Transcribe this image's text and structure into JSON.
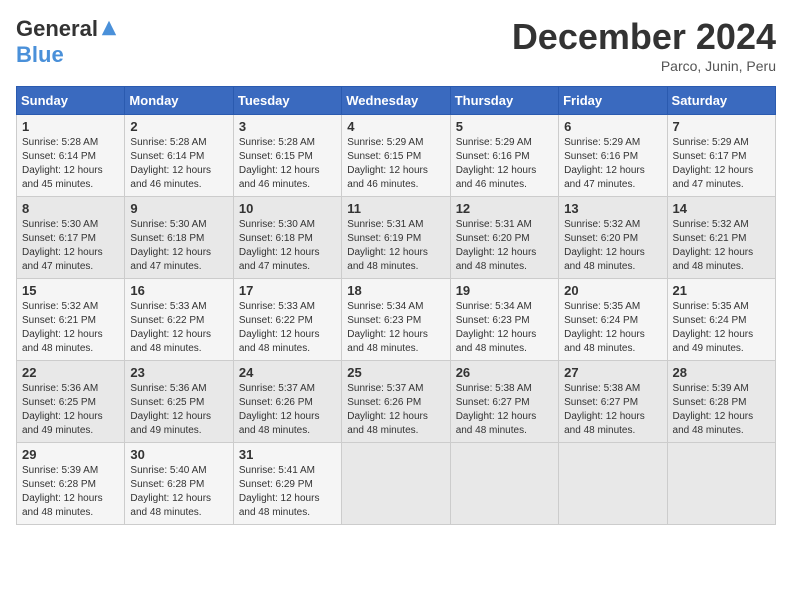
{
  "header": {
    "logo_general": "General",
    "logo_blue": "Blue",
    "title": "December 2024",
    "location": "Parco, Junin, Peru"
  },
  "weekdays": [
    "Sunday",
    "Monday",
    "Tuesday",
    "Wednesday",
    "Thursday",
    "Friday",
    "Saturday"
  ],
  "weeks": [
    [
      {
        "day": "1",
        "sunrise": "5:28 AM",
        "sunset": "6:14 PM",
        "daylight": "12 hours and 45 minutes."
      },
      {
        "day": "2",
        "sunrise": "5:28 AM",
        "sunset": "6:14 PM",
        "daylight": "12 hours and 46 minutes."
      },
      {
        "day": "3",
        "sunrise": "5:28 AM",
        "sunset": "6:15 PM",
        "daylight": "12 hours and 46 minutes."
      },
      {
        "day": "4",
        "sunrise": "5:29 AM",
        "sunset": "6:15 PM",
        "daylight": "12 hours and 46 minutes."
      },
      {
        "day": "5",
        "sunrise": "5:29 AM",
        "sunset": "6:16 PM",
        "daylight": "12 hours and 46 minutes."
      },
      {
        "day": "6",
        "sunrise": "5:29 AM",
        "sunset": "6:16 PM",
        "daylight": "12 hours and 47 minutes."
      },
      {
        "day": "7",
        "sunrise": "5:29 AM",
        "sunset": "6:17 PM",
        "daylight": "12 hours and 47 minutes."
      }
    ],
    [
      {
        "day": "8",
        "sunrise": "5:30 AM",
        "sunset": "6:17 PM",
        "daylight": "12 hours and 47 minutes."
      },
      {
        "day": "9",
        "sunrise": "5:30 AM",
        "sunset": "6:18 PM",
        "daylight": "12 hours and 47 minutes."
      },
      {
        "day": "10",
        "sunrise": "5:30 AM",
        "sunset": "6:18 PM",
        "daylight": "12 hours and 47 minutes."
      },
      {
        "day": "11",
        "sunrise": "5:31 AM",
        "sunset": "6:19 PM",
        "daylight": "12 hours and 48 minutes."
      },
      {
        "day": "12",
        "sunrise": "5:31 AM",
        "sunset": "6:20 PM",
        "daylight": "12 hours and 48 minutes."
      },
      {
        "day": "13",
        "sunrise": "5:32 AM",
        "sunset": "6:20 PM",
        "daylight": "12 hours and 48 minutes."
      },
      {
        "day": "14",
        "sunrise": "5:32 AM",
        "sunset": "6:21 PM",
        "daylight": "12 hours and 48 minutes."
      }
    ],
    [
      {
        "day": "15",
        "sunrise": "5:32 AM",
        "sunset": "6:21 PM",
        "daylight": "12 hours and 48 minutes."
      },
      {
        "day": "16",
        "sunrise": "5:33 AM",
        "sunset": "6:22 PM",
        "daylight": "12 hours and 48 minutes."
      },
      {
        "day": "17",
        "sunrise": "5:33 AM",
        "sunset": "6:22 PM",
        "daylight": "12 hours and 48 minutes."
      },
      {
        "day": "18",
        "sunrise": "5:34 AM",
        "sunset": "6:23 PM",
        "daylight": "12 hours and 48 minutes."
      },
      {
        "day": "19",
        "sunrise": "5:34 AM",
        "sunset": "6:23 PM",
        "daylight": "12 hours and 48 minutes."
      },
      {
        "day": "20",
        "sunrise": "5:35 AM",
        "sunset": "6:24 PM",
        "daylight": "12 hours and 48 minutes."
      },
      {
        "day": "21",
        "sunrise": "5:35 AM",
        "sunset": "6:24 PM",
        "daylight": "12 hours and 49 minutes."
      }
    ],
    [
      {
        "day": "22",
        "sunrise": "5:36 AM",
        "sunset": "6:25 PM",
        "daylight": "12 hours and 49 minutes."
      },
      {
        "day": "23",
        "sunrise": "5:36 AM",
        "sunset": "6:25 PM",
        "daylight": "12 hours and 49 minutes."
      },
      {
        "day": "24",
        "sunrise": "5:37 AM",
        "sunset": "6:26 PM",
        "daylight": "12 hours and 48 minutes."
      },
      {
        "day": "25",
        "sunrise": "5:37 AM",
        "sunset": "6:26 PM",
        "daylight": "12 hours and 48 minutes."
      },
      {
        "day": "26",
        "sunrise": "5:38 AM",
        "sunset": "6:27 PM",
        "daylight": "12 hours and 48 minutes."
      },
      {
        "day": "27",
        "sunrise": "5:38 AM",
        "sunset": "6:27 PM",
        "daylight": "12 hours and 48 minutes."
      },
      {
        "day": "28",
        "sunrise": "5:39 AM",
        "sunset": "6:28 PM",
        "daylight": "12 hours and 48 minutes."
      }
    ],
    [
      {
        "day": "29",
        "sunrise": "5:39 AM",
        "sunset": "6:28 PM",
        "daylight": "12 hours and 48 minutes."
      },
      {
        "day": "30",
        "sunrise": "5:40 AM",
        "sunset": "6:28 PM",
        "daylight": "12 hours and 48 minutes."
      },
      {
        "day": "31",
        "sunrise": "5:41 AM",
        "sunset": "6:29 PM",
        "daylight": "12 hours and 48 minutes."
      },
      null,
      null,
      null,
      null
    ]
  ]
}
